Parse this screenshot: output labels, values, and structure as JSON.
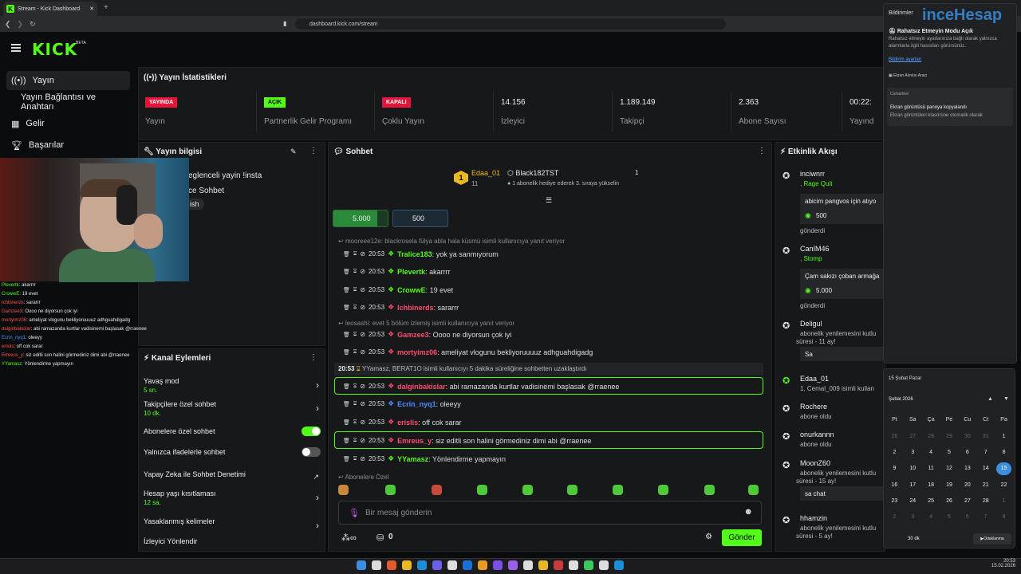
{
  "browser": {
    "tab_title": "Stream - Kick Dashboard",
    "url": "dashboard.kick.com/stream"
  },
  "brand": {
    "logo": "KICK",
    "beta": "BETA"
  },
  "colors": {
    "accent": "#53fc18",
    "live": "#e5143a",
    "closed": "#e5143a"
  },
  "nav": {
    "items": [
      {
        "label": "Yayın",
        "icon": "broadcast-icon"
      },
      {
        "label": "Yayın Bağlantısı ve Anahtarı"
      },
      {
        "label": "Gelir",
        "icon": "chart-icon"
      },
      {
        "label": "Başarılar",
        "icon": "trophy-icon"
      }
    ]
  },
  "stats": {
    "title": "Yayın İstatistikleri",
    "live_badge": "YAYINDA",
    "live_label": "Yayın",
    "partner_badge": "AÇIK",
    "partner_label": "Partnerlik Gelir Programı",
    "multi_badge": "KAPALI",
    "multi_label": "Çoklu Yayın",
    "viewers": "14.156",
    "viewers_label": "İzleyici",
    "followers": "1.189.149",
    "followers_label": "Takipçi",
    "subs": "2.363",
    "subs_label": "Abone Sayısı",
    "time": "00:22:",
    "time_label": "Yayınd"
  },
  "info": {
    "title": "Yayın bilgisi",
    "line1": "eglenceli yayin !insta",
    "line2": "ce Sohbet",
    "line3": "ish"
  },
  "overlay_chat": [
    {
      "user": "Plevertk",
      "text": ": akarrrr",
      "color": "#53fc18"
    },
    {
      "user": "CrowwE",
      "text": ": 19 evet",
      "color": "#53fc18"
    },
    {
      "user": "Ichbinerds",
      "text": ": sararrr",
      "color": "#ff4d4d"
    },
    {
      "user": "Gamzee3",
      "text": ": Oooo ne diyorsun çok iyi",
      "color": "#ff4d4d"
    },
    {
      "user": "mortyimz06",
      "text": ": ameliyat vlogunu bekliyoruuuuz adhguahdigadg",
      "color": "#ff4d4d"
    },
    {
      "user": "dalginbakislar",
      "text": ": abi ramazanda kurtlar vadisinemi başlasak @rraenee",
      "color": "#ff4d4d"
    },
    {
      "user": "Ecrin_nyq1",
      "text": ": oleeyy",
      "color": "#4d8cff"
    },
    {
      "user": "erislis",
      "text": ": off cok sarar",
      "color": "#ff4d4d"
    },
    {
      "user": "Emreus_y",
      "text": ": siz editli son halini görmediniz dimi abi @rraenee",
      "color": "#ff4d4d"
    },
    {
      "user": "YYamasz",
      "text": ": Yönlendirme yapmayın",
      "color": "#53fc18"
    }
  ],
  "kanal": {
    "title": "Kanal Eylemleri",
    "rows": [
      {
        "label": "Yavaş mod",
        "sub": "5 sn."
      },
      {
        "label": "Takipçilere özel sohbet",
        "sub": "10 dk."
      },
      {
        "label": "Abonelere özel sohbet"
      },
      {
        "label": "Yalnızca ifadelerle sohbet"
      },
      {
        "label": "Yapay Zeka ile Sohbet Denetimi"
      },
      {
        "label": "Hesap yaşı kısıtlaması",
        "sub": "12 sa."
      },
      {
        "label": "Yasaklanmış kelimeler"
      },
      {
        "label": "İzleyici Yönlendir"
      }
    ]
  },
  "chat": {
    "title": "Sohbet",
    "pinned_user": "Edaa_01",
    "pinned_count": "11",
    "gift_user": "Black182TST",
    "gift_count": "1",
    "gift_text": "1 abonelik hediye ederek 3. sıraya yükselin",
    "goal1": "5.000",
    "goal2": "500",
    "reply1": "mooreee12e: blackrosela fülya abla hala küsmü isimli kullanıcıya yanıt veriyor",
    "reply2": "leosashi: evet 5 bölüm izlemiş isimli kullanıcıya yanıt veriyor",
    "timeout": "20:53",
    "timeout_text": "YYamasz, BERAT1O isimli kullanıcıyı 5 dakika süreliğine sohbetten uzaklaştırdı",
    "messages": [
      {
        "time": "20:53",
        "user": "Tralice183",
        "text": ": yok ya sanmıyorum",
        "color": "#53fc18"
      },
      {
        "time": "20:53",
        "user": "Plevertk",
        "text": ": akarrrr",
        "color": "#53fc18"
      },
      {
        "time": "20:53",
        "user": "CrowwE",
        "text": ": 19 evet",
        "color": "#53fc18"
      },
      {
        "time": "20:53",
        "user": "Ichbinerds",
        "text": ": sararrr",
        "color": "#ff4d6d"
      },
      {
        "time": "20:53",
        "user": "Gamzee3",
        "text": ": Oooo ne diyorsun çok iyi",
        "color": "#ff4d6d"
      },
      {
        "time": "20:53",
        "user": "mortyimz06",
        "text": ": ameliyat vlogunu bekliyoruuuuz adhguahdigadg",
        "color": "#ff4d6d"
      },
      {
        "time": "20:53",
        "user": "dalginbakislar",
        "text": ": abi ramazanda kurtlar vadisinemi başlasak @rraenee",
        "color": "#ff4d6d"
      },
      {
        "time": "20:53",
        "user": "Ecrin_nyq1",
        "text": ": oleeyy",
        "color": "#4d8cff"
      },
      {
        "time": "20:53",
        "user": "erislis",
        "text": ": off cok sarar",
        "color": "#ff4d6d"
      },
      {
        "time": "20:53",
        "user": "Emreus_y",
        "text": ": siz editli son halini görmediniz dimi abi @rraenee",
        "color": "#ff4d6d"
      },
      {
        "time": "20:53",
        "user": "YYamasz",
        "text": ": Yönlendirme yapmayın",
        "color": "#53fc18"
      }
    ],
    "sub_emotes_label": "Abonelere Özel",
    "input_placeholder": "Bir mesaj gönderin",
    "count": "0",
    "send": "Gönder"
  },
  "feed": {
    "title": "Etkinlik Akışı",
    "items": [
      {
        "user": "inciwnrr",
        "sub": ", Rage Quit",
        "box": "abicim pangvos için atıyo",
        "amount": "500",
        "foot": "gönderdi"
      },
      {
        "user": "CanIM46",
        "sub": ", Stomp",
        "box": "Çam sakızı çoban armağa",
        "amount": "5.000",
        "foot": "gönderdi"
      },
      {
        "user": "Deligul",
        "sub": "abonelik yenilemesini kutlu",
        "sub2": "süresi - 11 ay!",
        "box": "Sa"
      },
      {
        "user": "Edaa_01",
        "sub": "1, Cemal_009 isimli kullan"
      },
      {
        "user": "Rochere",
        "sub": "abone oldu"
      },
      {
        "user": "onurkannn",
        "sub": "abone oldu"
      },
      {
        "user": "MoonZ60",
        "sub": "abonelik yenilemesini kutlu",
        "sub2": "süresi - 15 ay!",
        "box": "sa chat"
      },
      {
        "user": "hhamzin",
        "sub": "abonelik yenilemesini kutlu",
        "sub2": "süresi - 5 ay!"
      }
    ]
  },
  "notifications": {
    "title": "Bildirimler",
    "watermark": "inceHesap",
    "dnd_title": "Rahatsız Etmeyin Modu Açık",
    "dnd_text": "Rahatsız etmeyin ayarlarınıza bağlı olarak yalnızca alarmlarla ilgili hasısiları görürsünüz.",
    "settings_link": "Bildirim ayarları",
    "tool": "Ekran Alıntısı Aracı",
    "day": "Cumartesi",
    "shot_title": "Ekran görüntüsü panoya kopyalandı",
    "shot_text": "Ekran görüntüleri klasörüne otomatik olarak"
  },
  "calendar": {
    "header": "15 Şubat Pazar",
    "month": "Şubat 2026",
    "weekdays": [
      "Pt",
      "Sa",
      "Ça",
      "Pe",
      "Cu",
      "Ct",
      "Pa"
    ],
    "days": [
      "26",
      "27",
      "28",
      "29",
      "30",
      "31",
      "1",
      "2",
      "3",
      "4",
      "5",
      "6",
      "7",
      "8",
      "9",
      "10",
      "11",
      "12",
      "13",
      "14",
      "15",
      "16",
      "17",
      "18",
      "19",
      "20",
      "21",
      "22",
      "23",
      "24",
      "25",
      "26",
      "27",
      "28",
      "1",
      "2",
      "3",
      "4",
      "5",
      "6",
      "7",
      "8"
    ],
    "today": "15",
    "focus_value": "30 dk",
    "focus_label": "Odaklanma"
  },
  "taskbar": {
    "time": "20:53",
    "date": "15.02.2026"
  }
}
